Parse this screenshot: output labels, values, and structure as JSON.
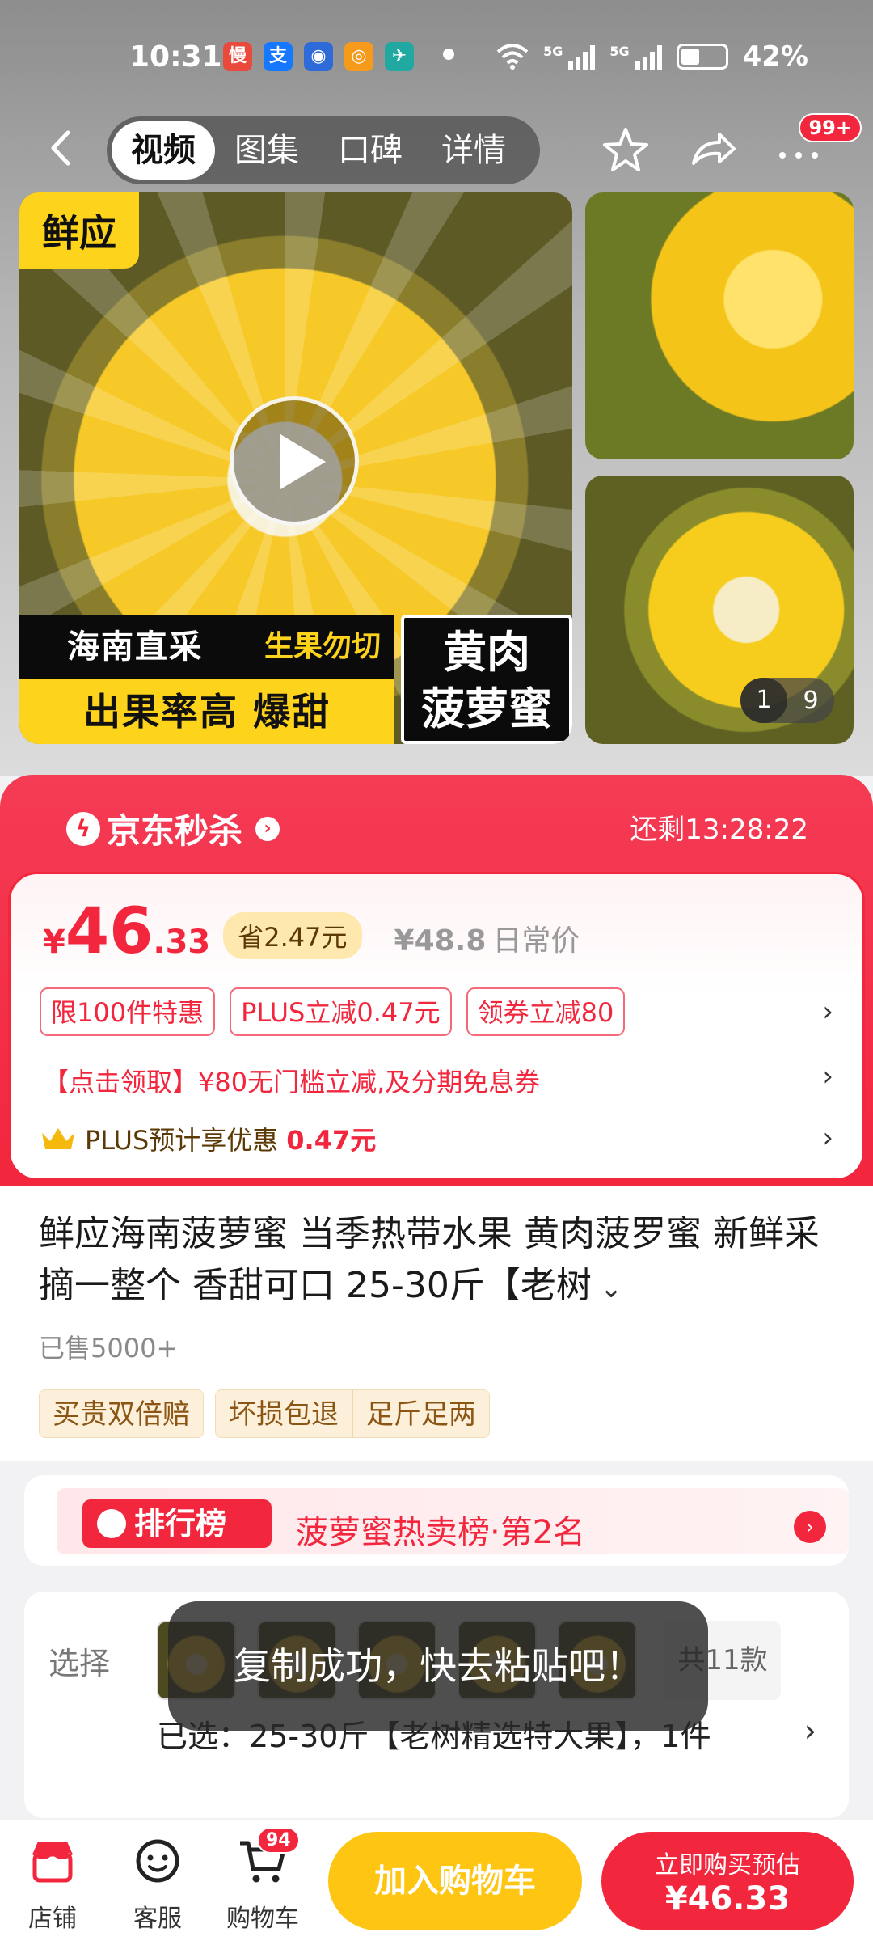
{
  "status": {
    "time": "10:31",
    "net1": "5G",
    "net2": "5G",
    "battery": "42%"
  },
  "nav": {
    "tabs": [
      "视频",
      "图集",
      "口碑",
      "详情"
    ],
    "badge": "99+"
  },
  "media": {
    "tag": "鲜应",
    "banner_1": "海南直采",
    "banner_2": "生果勿切",
    "banner_3": "出果率高 爆甜",
    "banner_4_line1": "黄肉",
    "banner_4_line2": "菠萝蜜",
    "counter_current": "1",
    "counter_total": "9"
  },
  "flash": {
    "title": "京东秒杀",
    "remaining": "还剩13:28:22",
    "yen": "¥",
    "price_int": "46",
    "price_dec": ".33",
    "save": "省2.47元",
    "orig_price": "¥48.8",
    "orig_label": "日常价",
    "coupons": [
      "限100件特惠",
      "PLUS立减0.47元",
      "领券立减80"
    ],
    "promo": "【点击领取】¥80无门槛立减,及分期免息券",
    "plus_text": "PLUS预计享优惠",
    "plus_amount": "0.47元"
  },
  "product": {
    "title": "鲜应海南菠萝蜜 当季热带水果 黄肉菠罗蜜 新鲜采摘一整个 香甜可口 25-30斤【老树",
    "sold": "已售5000+",
    "tags": [
      "买贵双倍赔",
      "坏损包退",
      "足斤足两"
    ]
  },
  "rank": {
    "badge": "排行榜",
    "text": "菠萝蜜热卖榜·第2名"
  },
  "select": {
    "label": "选择",
    "count": "共11款",
    "chosen": "已选：25-30斤【老树精选特大果】，1件"
  },
  "toast": "复制成功，快去粘贴吧！",
  "bottom": {
    "shop": "店铺",
    "service": "客服",
    "cart": "购物车",
    "cart_count": "94",
    "add_cart": "加入购物车",
    "buy_line1": "立即购买预估",
    "buy_line2": "¥46.33"
  },
  "colors": {
    "accent": "#f2263d",
    "cart_button": "#ffc513"
  }
}
